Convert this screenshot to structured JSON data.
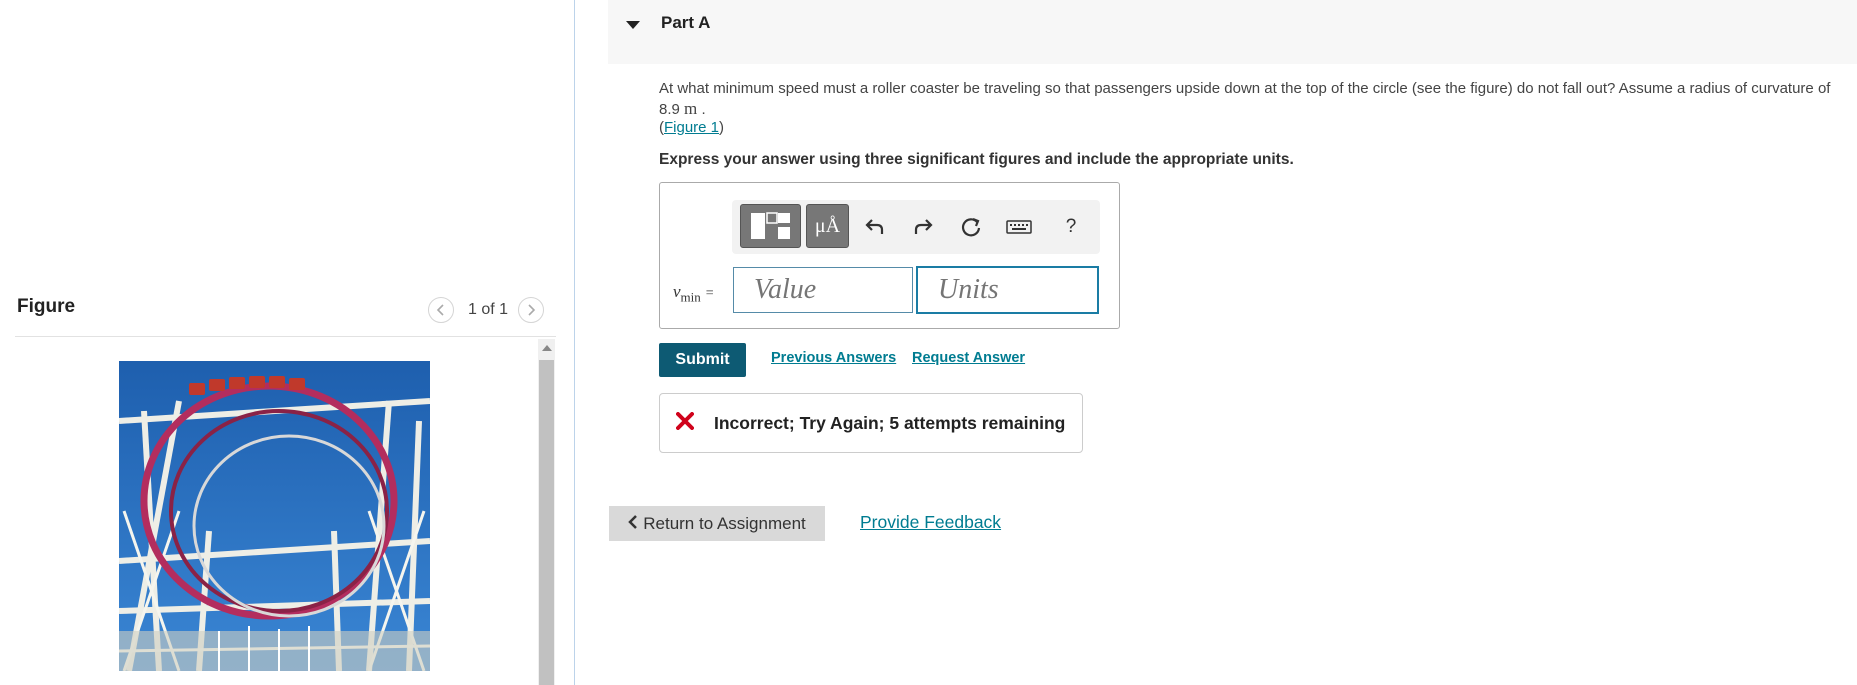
{
  "figure_panel": {
    "title": "Figure",
    "counter": "1 of 1",
    "prev_icon": "chevron-left-icon",
    "next_icon": "chevron-right-icon",
    "image_subject": "roller-coaster-loop-photo",
    "colors": {
      "sky": "#1f63b4",
      "track": "#b33060",
      "supports": "#f0f0ea"
    }
  },
  "part": {
    "title": "Part A",
    "caret_icon": "caret-down-icon"
  },
  "question": {
    "text_before": "At what minimum speed must a roller coaster be traveling so that passengers upside down at the top of the circle (see the figure) do not fall out? Assume a radius of curvature of 8.9",
    "unit": "m",
    "text_after": ".",
    "figure_link_open": "(",
    "figure_link": "Figure 1",
    "figure_link_close": ")"
  },
  "instructions": "Express your answer using three significant figures and include the appropriate units.",
  "answer": {
    "variable": "v",
    "subscript": "min",
    "equals": "=",
    "value_placeholder": "Value",
    "units_placeholder": "Units",
    "toolbar": [
      {
        "name": "templates-icon"
      },
      {
        "name": "units-icon",
        "label": "μÅ"
      },
      {
        "name": "undo-icon"
      },
      {
        "name": "redo-icon"
      },
      {
        "name": "reset-icon"
      },
      {
        "name": "keyboard-icon"
      },
      {
        "name": "help-icon",
        "label": "?"
      }
    ]
  },
  "actions": {
    "submit": "Submit",
    "previous_answers": "Previous Answers",
    "request_answer": "Request Answer"
  },
  "feedback": {
    "icon": "error-x-icon",
    "message": "Incorrect; Try Again; 5 attempts remaining",
    "icon_color": "#d0021b"
  },
  "footer": {
    "return_label": "Return to Assignment",
    "provide_feedback": "Provide Feedback"
  },
  "colors": {
    "accent": "#007c91",
    "submit_bg": "#0d5a73",
    "input_border": "#1a7ca4"
  }
}
